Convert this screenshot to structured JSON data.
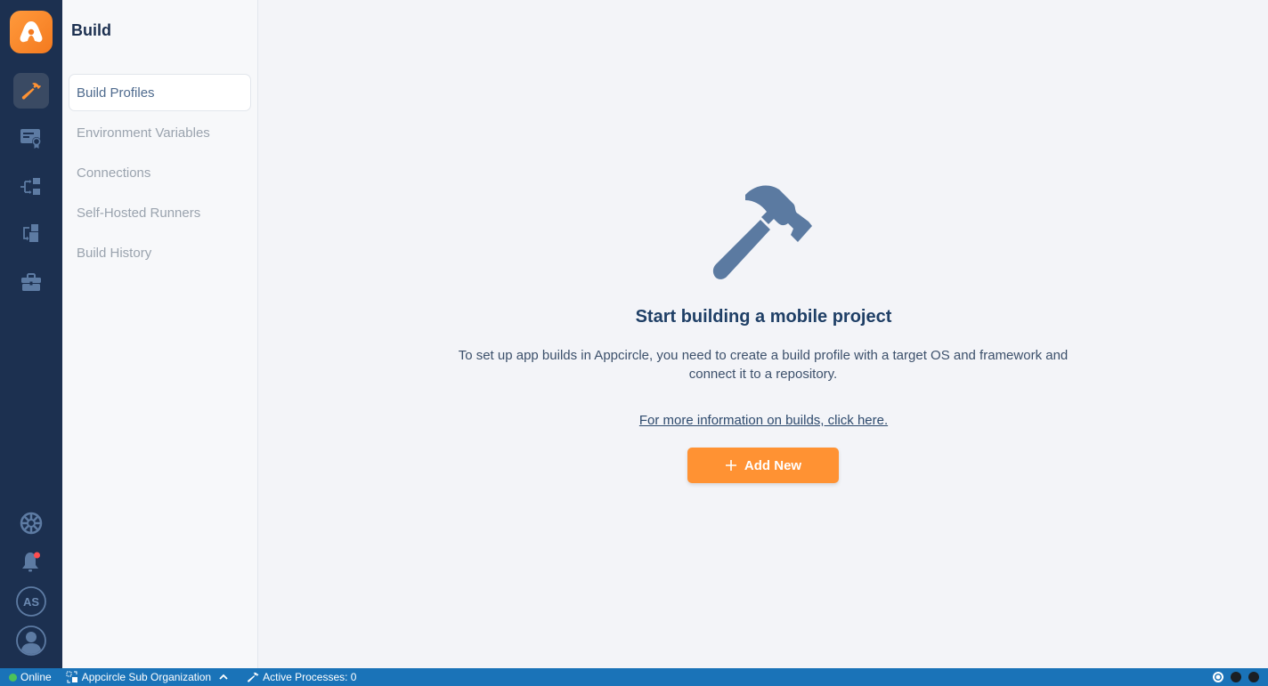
{
  "app": {
    "name": "Appcircle"
  },
  "rail": {
    "items": [
      {
        "id": "build",
        "icon": "hammer-icon",
        "active": true
      },
      {
        "id": "signing-identities",
        "icon": "certificate-icon",
        "active": false
      },
      {
        "id": "distribution",
        "icon": "distribution-icon",
        "active": false
      },
      {
        "id": "publish",
        "icon": "publish-icon",
        "active": false
      },
      {
        "id": "enterprise-store",
        "icon": "briefcase-icon",
        "active": false
      }
    ],
    "bottom": {
      "help_icon": "lifebuoy-icon",
      "notifications_icon": "bell-icon",
      "notification_dot_color": "#ff4d4f",
      "org_initials": "AS",
      "profile_icon": "user-icon"
    }
  },
  "sidebar": {
    "title": "Build",
    "items": [
      {
        "label": "Build Profiles",
        "active": true
      },
      {
        "label": "Environment Variables",
        "active": false
      },
      {
        "label": "Connections",
        "active": false
      },
      {
        "label": "Self-Hosted Runners",
        "active": false
      },
      {
        "label": "Build History",
        "active": false
      }
    ]
  },
  "main": {
    "empty_state": {
      "icon": "hammer-icon",
      "title": "Start building a mobile project",
      "description": "To set up app builds in Appcircle, you need to create a build profile with a target OS and framework and connect it to a repository.",
      "link_text": "For more information on builds, click here.",
      "button_label": "Add New"
    }
  },
  "statusbar": {
    "connection": "Online",
    "organization": "Appcircle Sub Organization",
    "active_processes": "Active Processes: 0"
  },
  "colors": {
    "accent": "#ff9233",
    "rail_bg": "#1c3050",
    "statusbar_bg": "#1a73b8",
    "online": "#4cc25a"
  }
}
